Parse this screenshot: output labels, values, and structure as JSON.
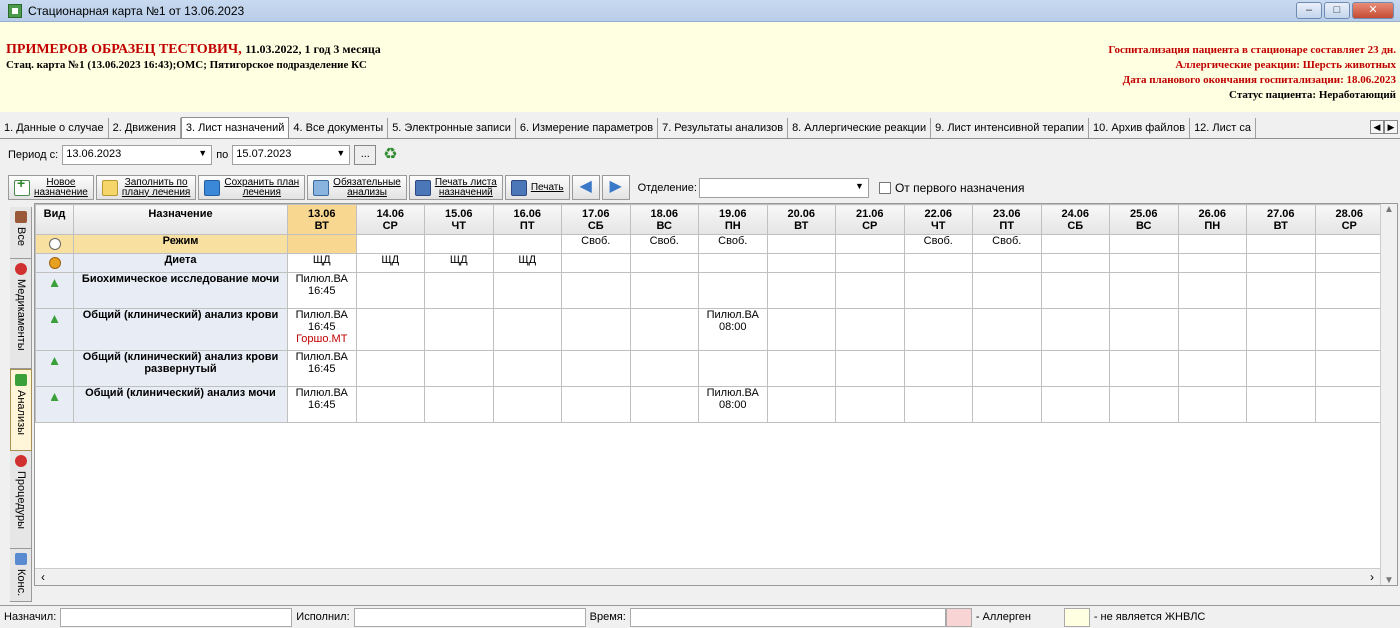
{
  "window": {
    "title": "Стационарная карта №1 от 13.06.2023"
  },
  "patient": {
    "name": "ПРИМЕРОВ ОБРАЗЕЦ ТЕСТОВИЧ,",
    "dob": "11.03.2022, 1 год 3 месяца",
    "card_line": "Стац. карта №1 (13.06.2023 16:43);ОМС; Пятигорское подразделение КС",
    "hospitalization": "Госпитализация пациента в стационаре составляет 23 дн.",
    "allergy": "Аллергические реакции: Шерсть животных",
    "planned_end": "Дата планового окончания госпитализации: 18.06.2023",
    "status": "Статус пациента: Неработающий"
  },
  "tabs": [
    "1. Данные о случае",
    "2. Движения",
    "3. Лист назначений",
    "4. Все документы",
    "5. Электронные записи",
    "6. Измерение параметров",
    "7. Результаты анализов",
    "8. Аллергические реакции",
    "9. Лист интенсивной терапии",
    "10. Архив файлов",
    "12. Лист са"
  ],
  "period": {
    "from_label": "Период с:",
    "from": "13.06.2023",
    "to_label": "по",
    "to": "15.07.2023",
    "dots": "..."
  },
  "toolbar": {
    "new": "Новое\nназначение",
    "fill": "Заполнить по\nплану лечения",
    "save_plan": "Сохранить план\nлечения",
    "obligatory": "Обязательные\nанализы",
    "print_list": "Печать листа\nназначений",
    "print": "Печать",
    "dept_label": "Отделение:",
    "dept_value": "",
    "first_appt": "От первого назначения"
  },
  "side_tabs": [
    "Все",
    "Медикаменты",
    "Анализы",
    "Процедуры",
    "Конс."
  ],
  "grid": {
    "col_kind": "Вид",
    "col_name": "Назначение",
    "dates": [
      {
        "d": "13.06",
        "w": "ВТ"
      },
      {
        "d": "14.06",
        "w": "СР"
      },
      {
        "d": "15.06",
        "w": "ЧТ"
      },
      {
        "d": "16.06",
        "w": "ПТ"
      },
      {
        "d": "17.06",
        "w": "СБ"
      },
      {
        "d": "18.06",
        "w": "ВС"
      },
      {
        "d": "19.06",
        "w": "ПН"
      },
      {
        "d": "20.06",
        "w": "ВТ"
      },
      {
        "d": "21.06",
        "w": "СР"
      },
      {
        "d": "22.06",
        "w": "ЧТ"
      },
      {
        "d": "23.06",
        "w": "ПТ"
      },
      {
        "d": "24.06",
        "w": "СБ"
      },
      {
        "d": "25.06",
        "w": "ВС"
      },
      {
        "d": "26.06",
        "w": "ПН"
      },
      {
        "d": "27.06",
        "w": "ВТ"
      },
      {
        "d": "28.06",
        "w": "СР"
      }
    ],
    "rows": [
      {
        "kind": "clock",
        "name": "Режим",
        "cells": [
          "",
          "",
          "",
          "",
          "Своб.",
          "Своб.",
          "Своб.",
          "",
          "",
          "Своб.",
          "Своб.",
          "",
          "",
          "",
          "",
          ""
        ]
      },
      {
        "kind": "food",
        "name": "Диета",
        "cells": [
          "ЩД",
          "ЩД",
          "ЩД",
          "ЩД",
          "",
          "",
          "",
          "",
          "",
          "",
          "",
          "",
          "",
          "",
          "",
          ""
        ]
      },
      {
        "kind": "lab",
        "name": "Биохимическое исследование мочи",
        "cells": [
          "Пилюл.ВА\n16:45",
          "",
          "",
          "",
          "",
          "",
          "",
          "",
          "",
          "",
          "",
          "",
          "",
          "",
          "",
          ""
        ]
      },
      {
        "kind": "lab",
        "name": "Общий (клинический) анализ крови",
        "cells": [
          "Пилюл.ВА\n16:45",
          "",
          "",
          "",
          "",
          "",
          "Пилюл.ВА\n08:00",
          "",
          "",
          "",
          "",
          "",
          "",
          "",
          "",
          ""
        ],
        "extra": "Горшо.МТ"
      },
      {
        "kind": "lab",
        "name": "Общий (клинический) анализ крови развернутый",
        "cells": [
          "Пилюл.ВА\n16:45",
          "",
          "",
          "",
          "",
          "",
          "",
          "",
          "",
          "",
          "",
          "",
          "",
          "",
          "",
          ""
        ]
      },
      {
        "kind": "lab",
        "name": "Общий (клинический) анализ мочи",
        "cells": [
          "Пилюл.ВА\n16:45",
          "",
          "",
          "",
          "",
          "",
          "Пилюл.ВА\n08:00",
          "",
          "",
          "",
          "",
          "",
          "",
          "",
          "",
          ""
        ]
      }
    ]
  },
  "status": {
    "assigned_label": "Назначил:",
    "executed_label": "Исполнил:",
    "time_label": "Время:",
    "allergen": "- Аллерген",
    "not_vital": "- не является ЖНВЛС"
  },
  "colors": {
    "today": "#f8d890",
    "allergen": "#f8d4d4",
    "not_vital": "#ffffe1",
    "accent_red": "#c00000"
  }
}
